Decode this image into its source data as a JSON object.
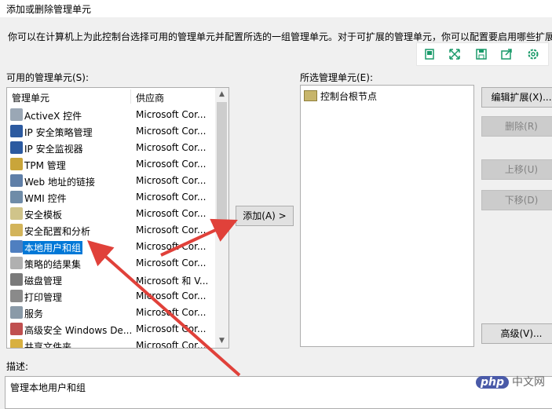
{
  "window": {
    "title": "添加或删除管理单元"
  },
  "intro_text": "你可以在计算机上为此控制台选择可用的管理单元并配置所选的一组管理单元。对于可扩展的管理单元，你可以配置要启用哪些扩展",
  "toolbar": {
    "icons": [
      "copy-icon",
      "expand-icon",
      "save-icon",
      "share-icon",
      "settings-icon"
    ]
  },
  "available": {
    "label": "可用的管理单元(S):",
    "col_name": "管理单元",
    "col_vendor": "供应商",
    "rows": [
      {
        "name": "ActiveX 控件",
        "vendor": "Microsoft Cor...",
        "icon": "activex-icon",
        "color": "#9aa7b5"
      },
      {
        "name": "IP 安全策略管理",
        "vendor": "Microsoft Cor...",
        "icon": "ip-policy-icon",
        "color": "#2c5aa0"
      },
      {
        "name": "IP 安全监视器",
        "vendor": "Microsoft Cor...",
        "icon": "ip-monitor-icon",
        "color": "#2c5aa0"
      },
      {
        "name": "TPM 管理",
        "vendor": "Microsoft Cor...",
        "icon": "tpm-icon",
        "color": "#c9a53a"
      },
      {
        "name": "Web 地址的链接",
        "vendor": "Microsoft Cor...",
        "icon": "web-link-icon",
        "color": "#5f7fa8"
      },
      {
        "name": "WMI 控件",
        "vendor": "Microsoft Cor...",
        "icon": "wmi-icon",
        "color": "#6f8ca8"
      },
      {
        "name": "安全模板",
        "vendor": "Microsoft Cor...",
        "icon": "security-template-icon",
        "color": "#d0c48a"
      },
      {
        "name": "安全配置和分析",
        "vendor": "Microsoft Cor...",
        "icon": "security-analysis-icon",
        "color": "#d3b45a"
      },
      {
        "name": "本地用户和组",
        "vendor": "Microsoft Cor...",
        "icon": "users-groups-icon",
        "color": "#4f7fc0",
        "selected": true
      },
      {
        "name": "策略的结果集",
        "vendor": "Microsoft Cor...",
        "icon": "rsop-icon",
        "color": "#b0b0b0"
      },
      {
        "name": "磁盘管理",
        "vendor": "Microsoft 和 V...",
        "icon": "disk-icon",
        "color": "#7a7a7a"
      },
      {
        "name": "打印管理",
        "vendor": "Microsoft Cor...",
        "icon": "printer-icon",
        "color": "#8a8a8a"
      },
      {
        "name": "服务",
        "vendor": "Microsoft Cor...",
        "icon": "services-icon",
        "color": "#8a9aa8"
      },
      {
        "name": "高级安全 Windows De...",
        "vendor": "Microsoft Cor...",
        "icon": "firewall-icon",
        "color": "#c05050"
      },
      {
        "name": "共享文件夹",
        "vendor": "Microsoft Cor...",
        "icon": "shared-folder-icon",
        "color": "#d8b040"
      }
    ]
  },
  "add_button": "添加(A) >",
  "selected": {
    "label": "所选管理单元(E):",
    "items": [
      "控制台根节点"
    ]
  },
  "side_buttons": {
    "edit_ext": "编辑扩展(X)...",
    "remove": "删除(R)",
    "move_up": "上移(U)",
    "move_down": "下移(D)",
    "advanced": "高级(V)..."
  },
  "description": {
    "label": "描述:",
    "text": "管理本地用户和组"
  },
  "watermark": {
    "badge": "php",
    "text": "中文网"
  },
  "colors": {
    "selection": "#0078d7",
    "arrow": "#e0413a"
  }
}
